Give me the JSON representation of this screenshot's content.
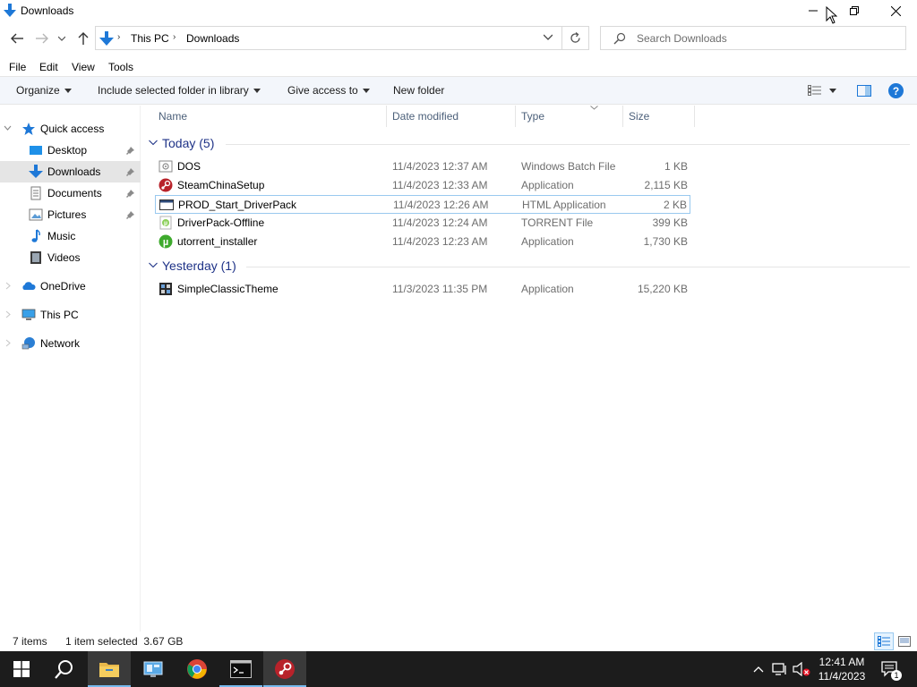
{
  "window": {
    "title": "Downloads"
  },
  "address": {
    "crumbs": [
      "This PC",
      "Downloads"
    ],
    "search_placeholder": "Search Downloads"
  },
  "menu": {
    "items": [
      "File",
      "Edit",
      "View",
      "Tools"
    ]
  },
  "commands": {
    "organize": "Organize",
    "include_library": "Include selected folder in library",
    "give_access": "Give access to",
    "new_folder": "New folder"
  },
  "nav": {
    "quick_access": "Quick access",
    "desktop": "Desktop",
    "downloads": "Downloads",
    "documents": "Documents",
    "pictures": "Pictures",
    "music": "Music",
    "videos": "Videos",
    "onedrive": "OneDrive",
    "this_pc": "This PC",
    "network": "Network"
  },
  "columns": {
    "name": "Name",
    "date": "Date modified",
    "type": "Type",
    "size": "Size"
  },
  "groups": [
    {
      "label": "Today (5)",
      "files": [
        {
          "name": "DOS",
          "date": "11/4/2023 12:37 AM",
          "type": "Windows Batch File",
          "size": "1 KB",
          "icon": "batch-file-icon"
        },
        {
          "name": "SteamChinaSetup",
          "date": "11/4/2023 12:33 AM",
          "type": "Application",
          "size": "2,115 KB",
          "icon": "steam-icon"
        },
        {
          "name": "PROD_Start_DriverPack",
          "date": "11/4/2023 12:26 AM",
          "type": "HTML Application",
          "size": "2 KB",
          "icon": "html-app-icon"
        },
        {
          "name": "DriverPack-Offline",
          "date": "11/4/2023 12:24 AM",
          "type": "TORRENT File",
          "size": "399 KB",
          "icon": "torrent-file-icon"
        },
        {
          "name": "utorrent_installer",
          "date": "11/4/2023 12:23 AM",
          "type": "Application",
          "size": "1,730 KB",
          "icon": "utorrent-icon"
        }
      ]
    },
    {
      "label": "Yesterday (1)",
      "files": [
        {
          "name": "SimpleClassicTheme",
          "date": "11/3/2023 11:35 PM",
          "type": "Application",
          "size": "15,220 KB",
          "icon": "app-icon"
        }
      ]
    }
  ],
  "status": {
    "items": "7 items",
    "selected": "1 item selected  3.67 GB"
  },
  "taskbar": {
    "time": "12:41 AM",
    "date": "11/4/2023",
    "notification_count": "1"
  },
  "colors": {
    "accent": "#0078d7",
    "group_header": "#1e3287",
    "taskbar": "#1c1c1c",
    "selected_nav": "#e5e5e5"
  }
}
